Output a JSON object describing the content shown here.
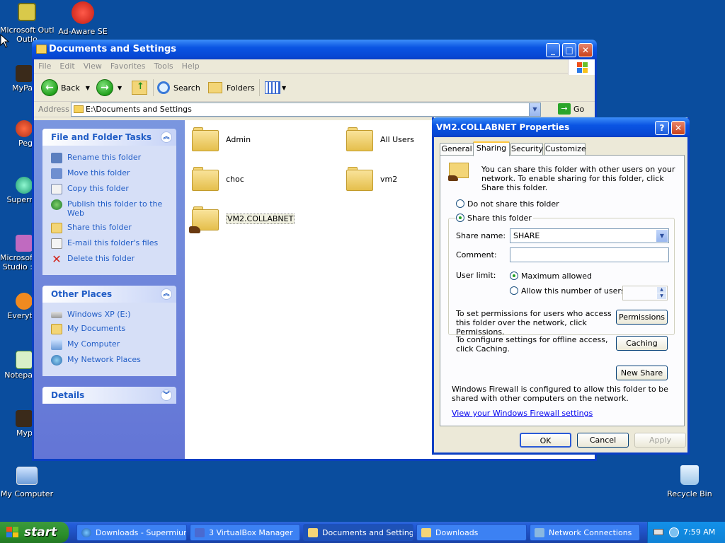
{
  "desktop": {
    "icons": [
      {
        "label": "Microsoft Outlo",
        "label2": "Outlo"
      },
      {
        "label": "Ad-Aware SE"
      },
      {
        "label": "MyPa"
      },
      {
        "label": "Peg"
      },
      {
        "label": "Superr"
      },
      {
        "label": "Microsoft",
        "label2": "Studio :"
      },
      {
        "label": "Everyt"
      },
      {
        "label": "Notepa"
      },
      {
        "label": "Myp"
      },
      {
        "label": "My Computer"
      },
      {
        "label": "Recycle Bin"
      }
    ]
  },
  "explorer": {
    "title": "Documents and Settings",
    "menu": [
      "File",
      "Edit",
      "View",
      "Favorites",
      "Tools",
      "Help"
    ],
    "toolbar": {
      "back": "Back",
      "search": "Search",
      "folders": "Folders"
    },
    "address": {
      "label": "Address",
      "path": "E:\\Documents and Settings",
      "go": "Go"
    },
    "file_tasks": {
      "title": "File and Folder Tasks",
      "items": [
        "Rename this folder",
        "Move this folder",
        "Copy this folder",
        "Publish this folder to the Web",
        "Share this folder",
        "E-mail this folder's files",
        "Delete this folder"
      ]
    },
    "other_places": {
      "title": "Other Places",
      "items": [
        "Windows XP (E:)",
        "My Documents",
        "My Computer",
        "My Network Places"
      ]
    },
    "details": {
      "title": "Details"
    },
    "folders": [
      "Admin",
      "All Users",
      "choc",
      "vm2",
      "VM2.COLLABNET"
    ]
  },
  "dialog": {
    "title": "VM2.COLLABNET Properties",
    "tabs": [
      "General",
      "Sharing",
      "Security",
      "Customize"
    ],
    "intro": "You can share this folder with other users on your network.  To enable sharing for this folder, click Share this folder.",
    "do_not_share": "Do not share this folder",
    "share": "Share this folder",
    "share_name_label": "Share name:",
    "share_name_value": "SHARE",
    "comment_label": "Comment:",
    "comment_value": "",
    "user_limit_label": "User limit:",
    "max_allowed": "Maximum allowed",
    "allow_number": "Allow this number of users:",
    "permissions_text": "To set permissions for users who access this folder over the network, click Permissions.",
    "permissions_btn": "Permissions",
    "caching_text": "To configure settings for offline access, click Caching.",
    "caching_btn": "Caching",
    "new_share_btn": "New Share",
    "firewall_text": "Windows Firewall is configured to allow this folder to be shared with other computers on the network.",
    "firewall_link": "View your Windows Firewall settings",
    "ok": "OK",
    "cancel": "Cancel",
    "apply": "Apply"
  },
  "taskbar": {
    "start": "start",
    "tasks": [
      "Downloads - Supermium",
      "3 VirtualBox Manager",
      "Documents and Settings",
      "Downloads",
      "Network Connections"
    ],
    "clock": "7:59 AM"
  },
  "colors": {
    "desktop": "#0a4d9e",
    "titlebar": "#0a54e3",
    "link": "#215dc6",
    "start": "#2b8f2b"
  }
}
